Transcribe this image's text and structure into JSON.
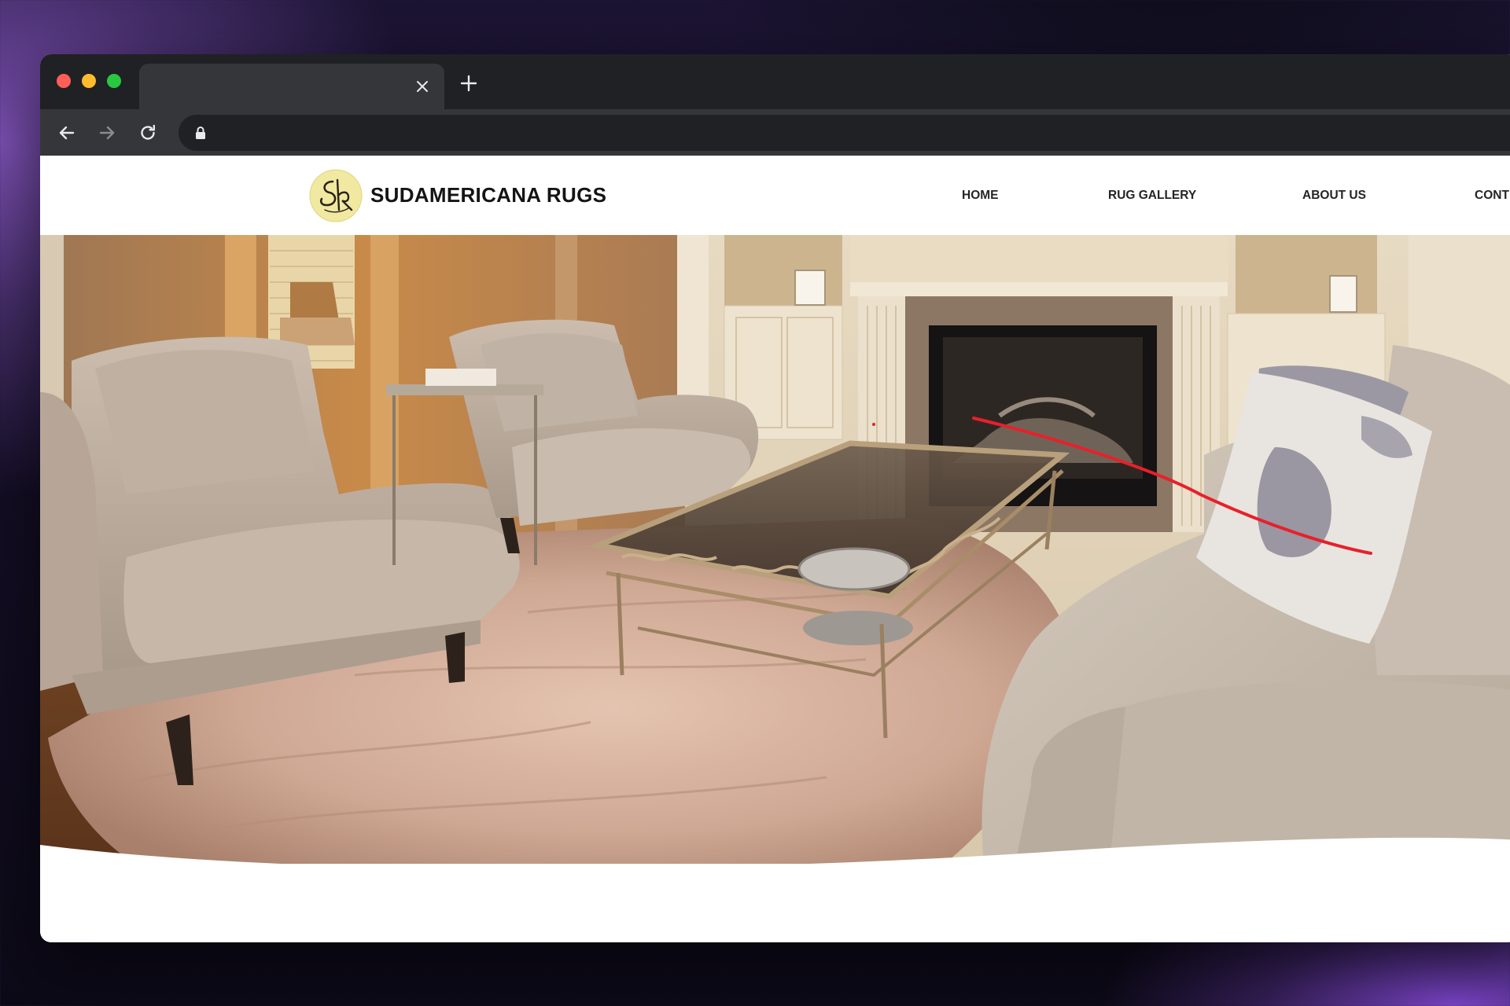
{
  "browser": {
    "tab": {
      "title": ""
    },
    "address_bar": {
      "url": ""
    }
  },
  "site": {
    "brand": {
      "name": "SUDAMERICANA RUGS",
      "logo_text": "SR"
    },
    "nav": {
      "home": "HOME",
      "gallery": "RUG GALLERY",
      "about": "ABOUT US",
      "contact": "CONT"
    }
  },
  "hero": {
    "image_description": "",
    "annotation_color": "#e8202a"
  },
  "colors": {
    "tab_strip": "#202124",
    "toolbar": "#35363a",
    "text_dark": "#141414",
    "logo_bg": "#f1e8a2"
  }
}
